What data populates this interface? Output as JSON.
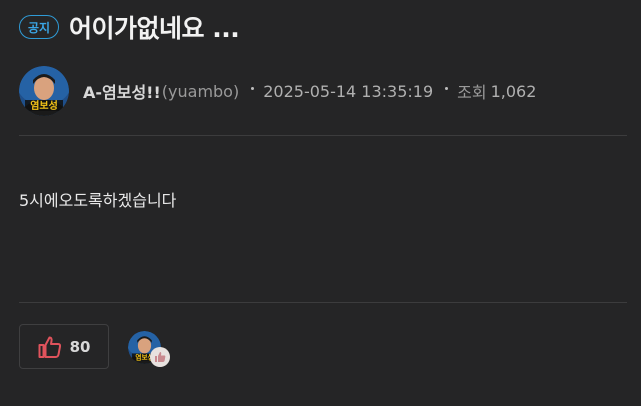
{
  "post": {
    "badge": "공지",
    "title": "어이가없네요 ...",
    "author": {
      "name": "A-염보성!!",
      "id": "(yuambo)",
      "avatar_caption": "염보성"
    },
    "datetime": "2025-05-14 13:35:19",
    "views_label": "조회",
    "views": "1,062",
    "body": "5시에오도록하겠습니다"
  },
  "likes": {
    "count": "80",
    "icon": "thumbs-up-icon",
    "color": "#e0535c"
  },
  "colors": {
    "background": "#252526",
    "badge": "#2f9bd6"
  }
}
